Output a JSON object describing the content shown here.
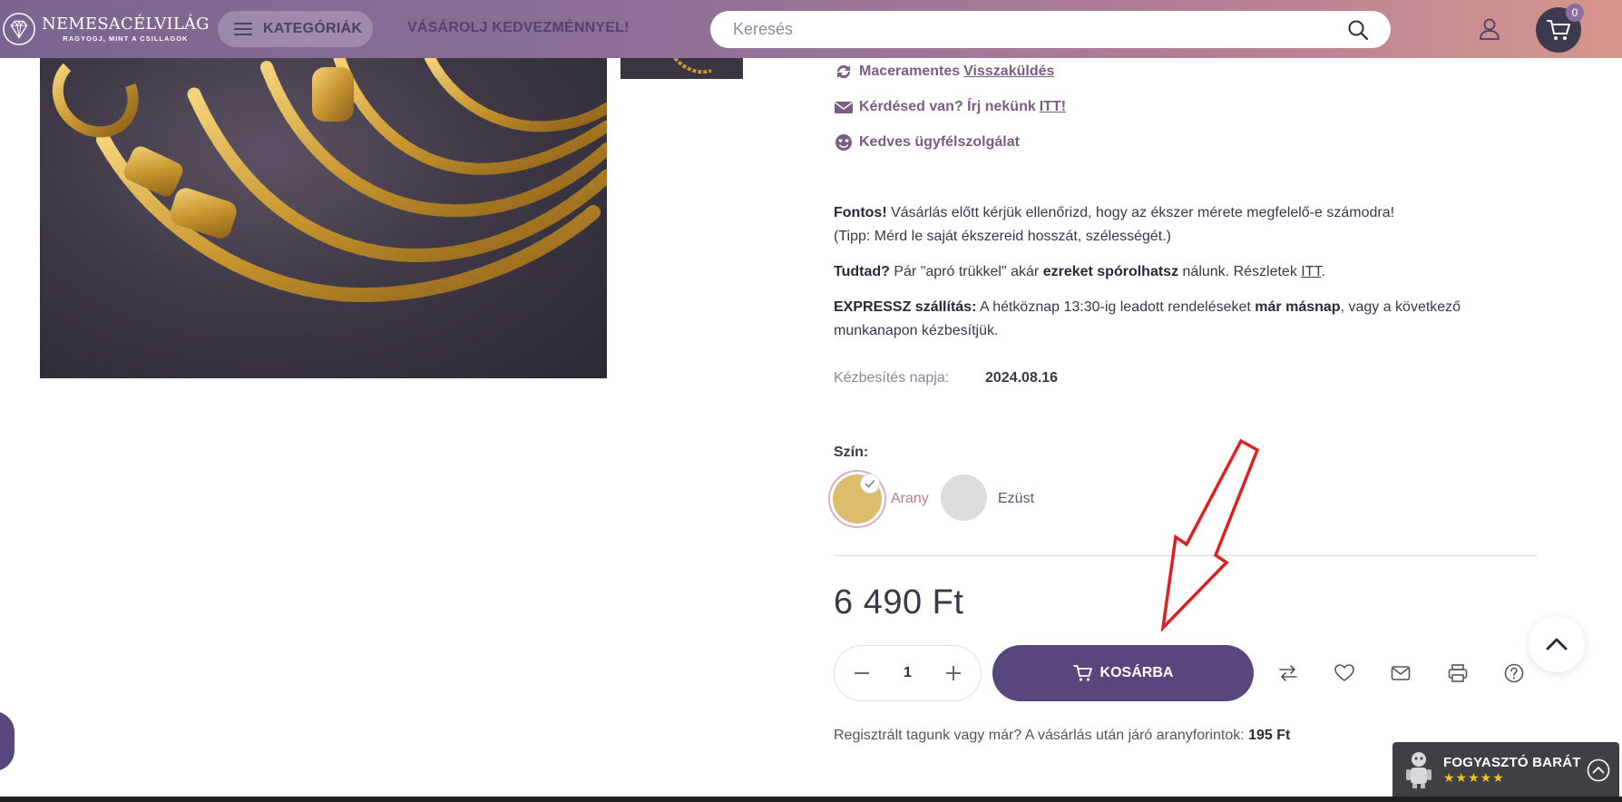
{
  "header": {
    "logo_name": "NEMESACÉLVILÁG",
    "logo_tagline": "RAGYOGJ, MINT A CSILLAGOK",
    "categories_label": "KATEGÓRIÁK",
    "promo_text": "VÁSÁROLJ KEDVEZMÉNNYEL!",
    "search_placeholder": "Keresés",
    "cart_count": "0"
  },
  "perks": {
    "returns_prefix": "Maceramentes",
    "returns_link": "Visszaküldés",
    "question_prefix": "Kérdésed van? Írj nekünk",
    "question_link": "ITT!",
    "support": "Kedves ügyfélszolgálat"
  },
  "notes": {
    "important_bold": "Fontos!",
    "important_text": "Vásárlás előtt kérjük ellenőrizd, hogy az ékszer mérete megfelelő-e számodra!",
    "tip_text": "(Tipp: Mérd le saját ékszereid hosszát, szélességét.)",
    "didyouknow_bold": "Tudtad?",
    "didyouknow_text1": "Pár \"apró trükkel\" akár",
    "didyouknow_bold2": "ezreket spórolhatsz",
    "didyouknow_text2": "nálunk. Részletek",
    "didyouknow_link": "ITT",
    "express_bold": "EXPRESSZ szállítás:",
    "express_text1": "A hétköznap 13:30-ig leadott rendeléseket",
    "express_bold2": "már másnap",
    "express_text2": ", vagy a következő",
    "express_text3": "munkanapon kézbesítjük."
  },
  "delivery": {
    "label": "Kézbesítés napja:",
    "value": "2024.08.16"
  },
  "color": {
    "label": "Szín:",
    "options": [
      {
        "name": "Arany",
        "selected": true,
        "swatch": "#dcbd6c"
      },
      {
        "name": "Ezüst",
        "selected": false,
        "swatch": "#dcdcdc"
      }
    ]
  },
  "price": "6 490 Ft",
  "quantity": "1",
  "add_to_cart_label": "KOSÁRBA",
  "action_icons": [
    "compare-icon",
    "heart-icon",
    "mail-icon",
    "print-icon",
    "question-icon"
  ],
  "loyalty": {
    "text": "Regisztrált tagunk vagy már? A vásárlás után járó aranyforintok:",
    "value": "195 Ft"
  },
  "badge": {
    "title": "FOGYASZTÓ BARÁT",
    "stars": "★★★★★"
  },
  "colors": {
    "header_start": "#7a6591",
    "header_end": "#d7978d",
    "brand_purple": "#57477c",
    "perk_text": "#7a5d83",
    "annotation_arrow": "#e02020"
  }
}
